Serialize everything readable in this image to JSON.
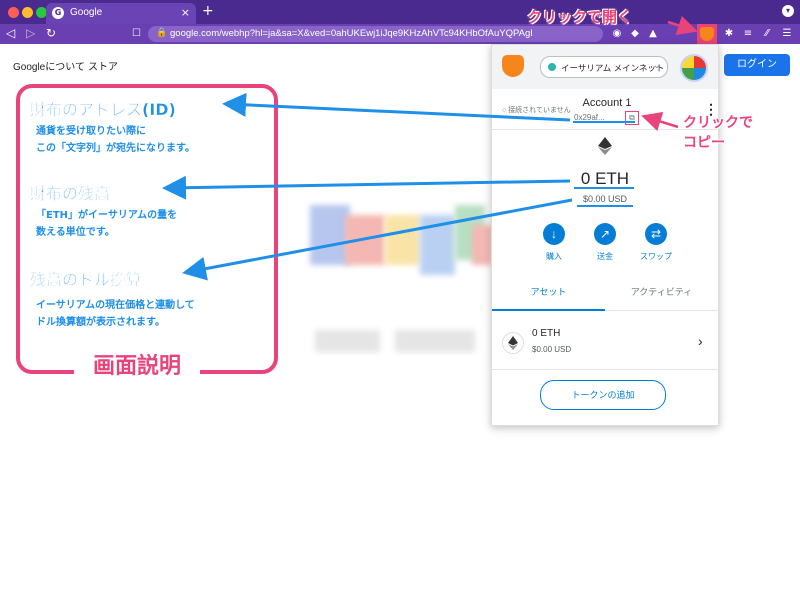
{
  "browser": {
    "tab_title": "Google",
    "new_tab": "+",
    "close_tab": "×",
    "url": "google.com/webhp?hl=ja&sa=X&ved=0ahUKEwj1iJqe9KHzAhVTc94KHbOfAuYQPAgI"
  },
  "google": {
    "about": "Googleについて",
    "store": "ストア",
    "login": "ログイン"
  },
  "metamask": {
    "network": "イーサリアム メインネット",
    "connection": "接続されていません",
    "account_name": "Account 1",
    "address_short": "0x29af...",
    "balance": "0 ETH",
    "balance_usd": "$0.00 USD",
    "actions": [
      {
        "label": "購入",
        "icon": "download-icon"
      },
      {
        "label": "送金",
        "icon": "send-arrow-icon"
      },
      {
        "label": "スワップ",
        "icon": "swap-icon"
      }
    ],
    "tabs": [
      {
        "label": "アセット",
        "active": true
      },
      {
        "label": "アクティビティ",
        "active": false
      }
    ],
    "asset": {
      "name": "0 ETH",
      "usd": "$0.00 USD"
    },
    "add_token": "トークンの追加"
  },
  "annotations": {
    "wallet_address_title": "財布のアドレス(ID)",
    "wallet_address_desc_1": "通貨を受け取りたい際に",
    "wallet_address_desc_2": "この「文字列」が宛先になります。",
    "balance_title": "財布の残高",
    "balance_desc_1": "「ETH」がイーサリアムの量を",
    "balance_desc_2": "数える単位です。",
    "usd_title": "残高のドル換算",
    "usd_desc_1": "イーサリアムの現在価格と連動して",
    "usd_desc_2": "ドル換算額が表示されます。",
    "screen_title": "画面説明",
    "click_open": "クリックで開く",
    "click_copy_1": "クリックで",
    "click_copy_2": "コピー"
  },
  "colors": {
    "accent_pink": "#e8447a",
    "annotation_blue": "#1f8fe8",
    "metamask_blue": "#037dd6",
    "browser_purple": "#6a3fb2"
  }
}
